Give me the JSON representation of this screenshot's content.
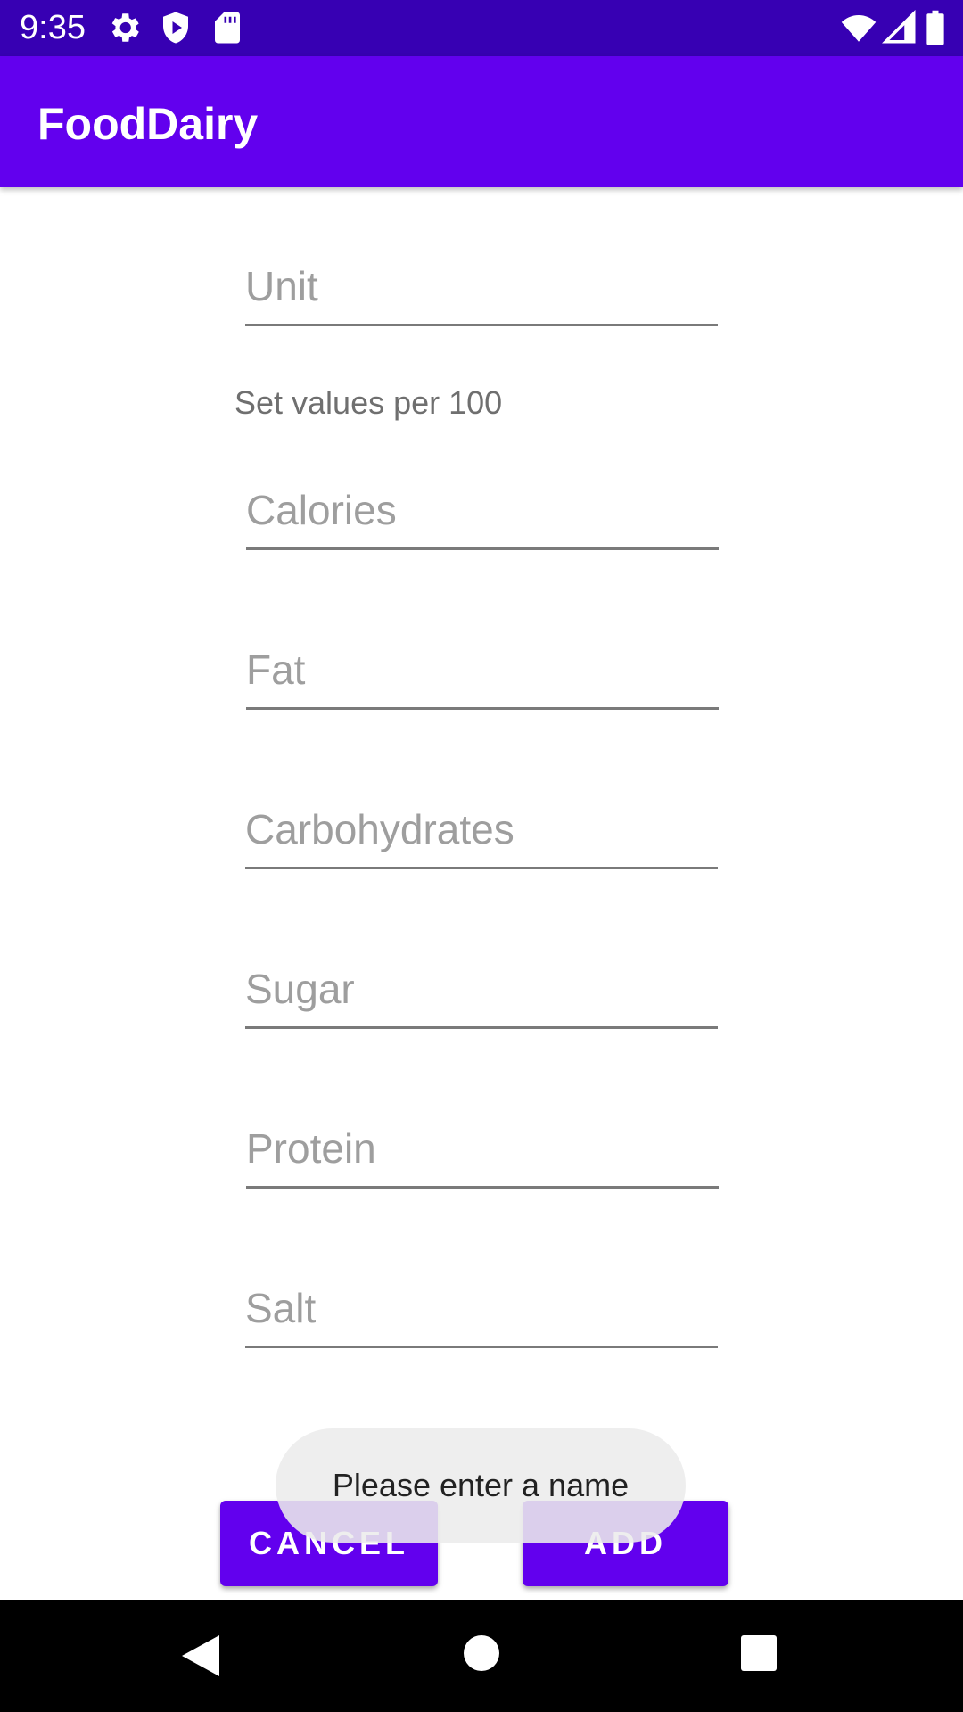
{
  "status_bar": {
    "time": "9:35",
    "left_icons": [
      "gear-icon",
      "shield-play-icon",
      "sd-card-icon"
    ],
    "right_icons": [
      "wifi-icon",
      "signal-icon",
      "battery-icon"
    ]
  },
  "app_bar": {
    "title": "FoodDairy"
  },
  "form": {
    "unit_placeholder": "Unit",
    "per_label": "Set values per 100",
    "calories_placeholder": "Calories",
    "fat_placeholder": "Fat",
    "carbohydrates_placeholder": "Carbohydrates",
    "sugar_placeholder": "Sugar",
    "protein_placeholder": "Protein",
    "salt_placeholder": "Salt"
  },
  "actions": {
    "cancel_label": "CANCEL",
    "add_label": "ADD"
  },
  "toast": {
    "message": "Please enter a name"
  },
  "colors": {
    "primary": "#6200ee",
    "primary_dark": "#3700b3"
  }
}
